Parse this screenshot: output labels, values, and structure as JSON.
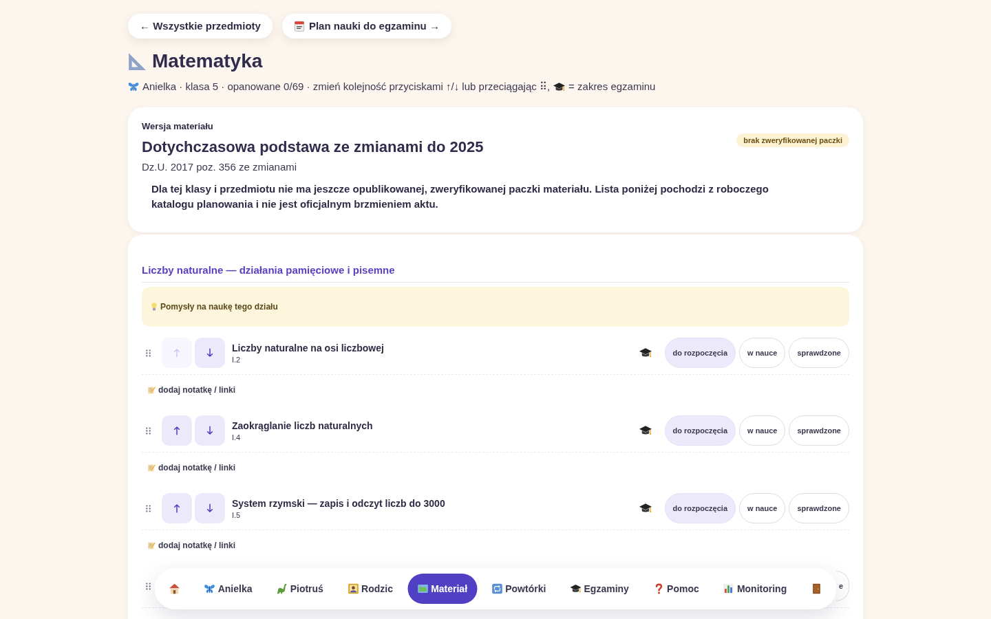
{
  "top_links": [
    {
      "kind": "back",
      "label": "← Wszystkie przedmioty"
    },
    {
      "kind": "plan",
      "label": "Plan nauki do egzaminu →"
    }
  ],
  "header": {
    "title": "Matematyka",
    "subtitle": [
      "Anielka · klasa 5 · opanowane 0/69 · zmień kolejność przyciskami ↑/↓ lub przeciągając ⠿,",
      "= zakres egzaminu"
    ]
  },
  "version_card": {
    "label": "Wersja materiału",
    "title": "Dotychczasowa podstawa ze zmianami do 2025",
    "badge": "brak zweryfikowanej paczki",
    "source": "Dz.U. 2017 poz. 356 ze zmianami",
    "notice": "Dla tej klasy i przedmiotu nie ma jeszcze opublikowanej, zweryfikowanej paczki materiału. Lista poniżej pochodzi z roboczego katalogu planowania i nie jest oficjalnym brzmieniem aktu."
  },
  "section": {
    "title": "Liczby naturalne — działania pamięciowe i pisemne",
    "ideas_label": "Pomysły na naukę tego działu"
  },
  "topics": [
    {
      "kind": "full",
      "title": "Liczby naturalne na osi liczbowej",
      "code": "I.2",
      "exam": true,
      "up_disabled": true,
      "down_disabled": false,
      "statuses": [
        {
          "label": "do rozpoczęcia",
          "selected": true
        },
        {
          "label": "w nauce",
          "selected": false
        },
        {
          "label": "sprawdzone",
          "selected": false
        }
      ],
      "note_link": "dodaj notatkę / linki"
    },
    {
      "kind": "full",
      "title": "Zaokrąglanie liczb naturalnych",
      "code": "I.4",
      "exam": true,
      "up_disabled": false,
      "down_disabled": false,
      "statuses": [
        {
          "label": "do rozpoczęcia",
          "selected": true
        },
        {
          "label": "w nauce",
          "selected": false
        },
        {
          "label": "sprawdzone",
          "selected": false
        }
      ],
      "note_link": "dodaj notatkę / linki"
    },
    {
      "kind": "full",
      "title": "System rzymski — zapis i odczyt liczb do 3000",
      "code": "I.5",
      "exam": true,
      "up_disabled": false,
      "down_disabled": false,
      "statuses": [
        {
          "label": "do rozpoczęcia",
          "selected": true
        },
        {
          "label": "w nauce",
          "selected": false
        },
        {
          "label": "sprawdzone",
          "selected": false
        }
      ],
      "note_link": "dodaj notatkę / linki"
    },
    {
      "kind": "covered",
      "statuses": [
        {
          "label": "e",
          "selected": false
        }
      ]
    }
  ],
  "nav": [
    {
      "kind": "home",
      "selected": false
    },
    {
      "kind": "profile",
      "label": "Anielka",
      "selected": false
    },
    {
      "kind": "profile",
      "label": "Piotruś",
      "selected": false
    },
    {
      "kind": "parent",
      "label": "Rodzic",
      "selected": false
    },
    {
      "kind": "material",
      "label": "Materiał",
      "selected": true
    },
    {
      "kind": "reviews",
      "label": "Powtórki",
      "selected": false
    },
    {
      "kind": "exams",
      "label": "Egzaminy",
      "selected": false
    },
    {
      "kind": "help",
      "label": "Pomoc",
      "selected": false
    },
    {
      "kind": "monitoring",
      "label": "Monitoring",
      "selected": false
    },
    {
      "kind": "exit",
      "selected": false
    }
  ]
}
